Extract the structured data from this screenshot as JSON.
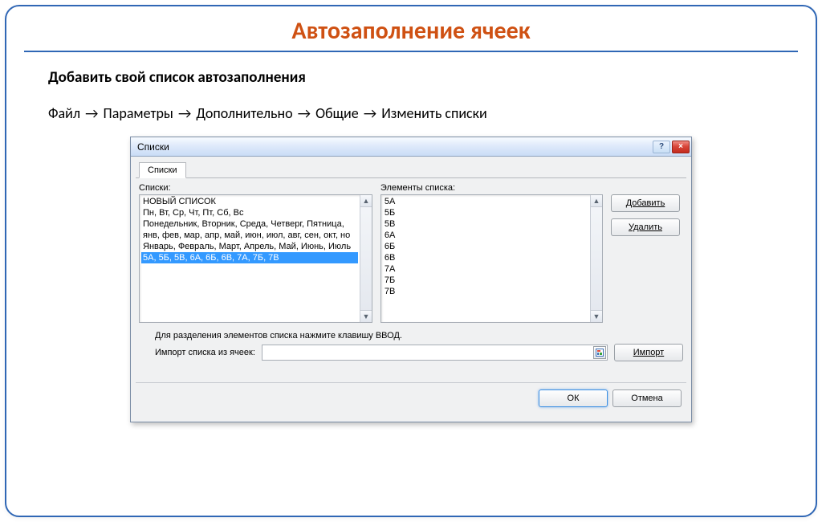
{
  "title": "Автозаполнение ячеек",
  "subtitle": "Добавить свой список автозаполнения",
  "nav_path": [
    "Файл",
    "Параметры",
    "Дополнительно",
    "Общие",
    "Изменить списки"
  ],
  "arrow_glyph": "→",
  "dialog": {
    "caption": "Списки",
    "help_glyph": "?",
    "close_glyph": "×",
    "tab_label": "Списки",
    "labels": {
      "lists": "Списки:",
      "elements": "Элементы списка:",
      "hint": "Для разделения элементов списка нажмите клавишу ВВОД.",
      "import_from": "Импорт списка из ячеек:"
    },
    "lists": [
      "НОВЫЙ СПИСОК",
      "Пн, Вт, Ср, Чт, Пт, Сб, Вс",
      "Понедельник, Вторник, Среда, Четверг, Пятница,",
      "янв, фев, мар, апр, май, июн, июл, авг, сен, окт, но",
      "Январь, Февраль, Март, Апрель, Май, Июнь, Июль",
      "5А, 5Б, 5В, 6А, 6Б, 6В, 7А, 7Б, 7В"
    ],
    "selected_index": 5,
    "elements": [
      "5А",
      "5Б",
      "5В",
      "6А",
      "6Б",
      "6В",
      "7А",
      "7Б",
      "7В"
    ],
    "buttons": {
      "add": "Добавить",
      "delete": "Удалить",
      "import": "Импорт",
      "ok": "ОК",
      "cancel": "Отмена"
    },
    "import_value": ""
  }
}
